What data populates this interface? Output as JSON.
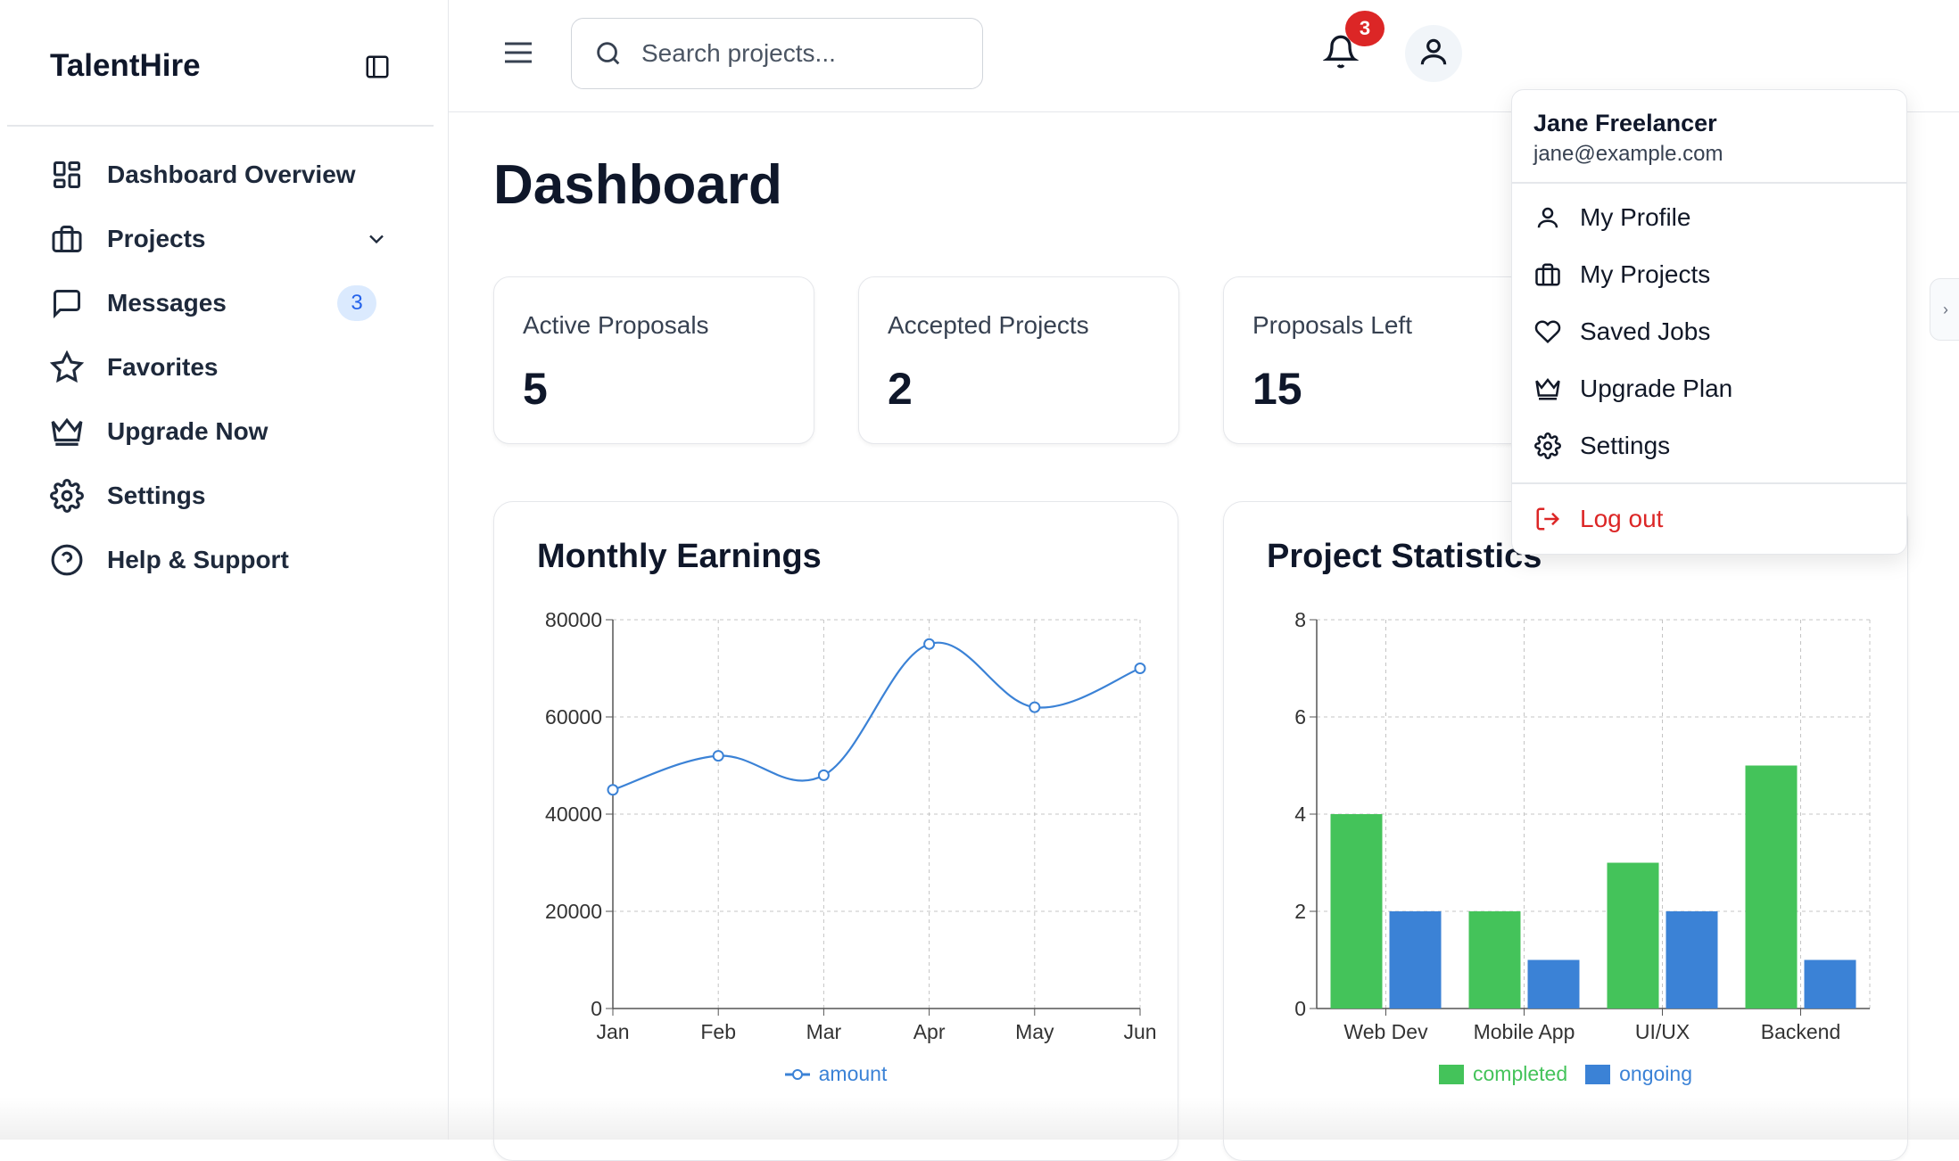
{
  "sidebar": {
    "brand": "TalentHire",
    "items": [
      {
        "label": "Dashboard Overview",
        "icon": "layout-grid-icon"
      },
      {
        "label": "Projects",
        "icon": "briefcase-icon",
        "expandable": true
      },
      {
        "label": "Messages",
        "icon": "message-square-icon",
        "badge": "3"
      },
      {
        "label": "Favorites",
        "icon": "star-icon"
      },
      {
        "label": "Upgrade Now",
        "icon": "crown-icon"
      },
      {
        "label": "Settings",
        "icon": "gear-icon"
      },
      {
        "label": "Help & Support",
        "icon": "help-circle-icon"
      }
    ]
  },
  "header": {
    "search_placeholder": "Search projects...",
    "notification_count": "3"
  },
  "main": {
    "title": "Dashboard",
    "stats": [
      {
        "label": "Active Proposals",
        "value": "5"
      },
      {
        "label": "Accepted Projects",
        "value": "2"
      },
      {
        "label": "Proposals Left",
        "value": "15"
      }
    ]
  },
  "user_menu": {
    "name": "Jane Freelancer",
    "email": "jane@example.com",
    "items": [
      {
        "label": "My Profile",
        "icon": "user-icon"
      },
      {
        "label": "My Projects",
        "icon": "briefcase-icon"
      },
      {
        "label": "Saved Jobs",
        "icon": "heart-icon"
      },
      {
        "label": "Upgrade Plan",
        "icon": "crown-icon"
      },
      {
        "label": "Settings",
        "icon": "gear-icon"
      }
    ],
    "logout": "Log out"
  },
  "chart_data": [
    {
      "type": "line",
      "title": "Monthly Earnings",
      "categories": [
        "Jan",
        "Feb",
        "Mar",
        "Apr",
        "May",
        "Jun"
      ],
      "series": [
        {
          "name": "amount",
          "values": [
            45000,
            52000,
            48000,
            75000,
            62000,
            70000
          ],
          "color": "#3b82d6"
        }
      ],
      "yticks": [
        "0",
        "20000",
        "40000",
        "60000",
        "80000"
      ],
      "ylim": [
        0,
        80000
      ],
      "grid": true,
      "legend": "bottom"
    },
    {
      "type": "bar",
      "title": "Project Statistics",
      "categories": [
        "Web Dev",
        "Mobile App",
        "UI/UX",
        "Backend"
      ],
      "series": [
        {
          "name": "completed",
          "values": [
            4,
            2,
            3,
            5
          ],
          "color": "#44c35a"
        },
        {
          "name": "ongoing",
          "values": [
            2,
            1,
            2,
            1
          ],
          "color": "#3b82d6"
        }
      ],
      "yticks": [
        "0",
        "2",
        "4",
        "6",
        "8"
      ],
      "ylim": [
        0,
        8
      ],
      "grid": true,
      "legend": "bottom"
    }
  ]
}
